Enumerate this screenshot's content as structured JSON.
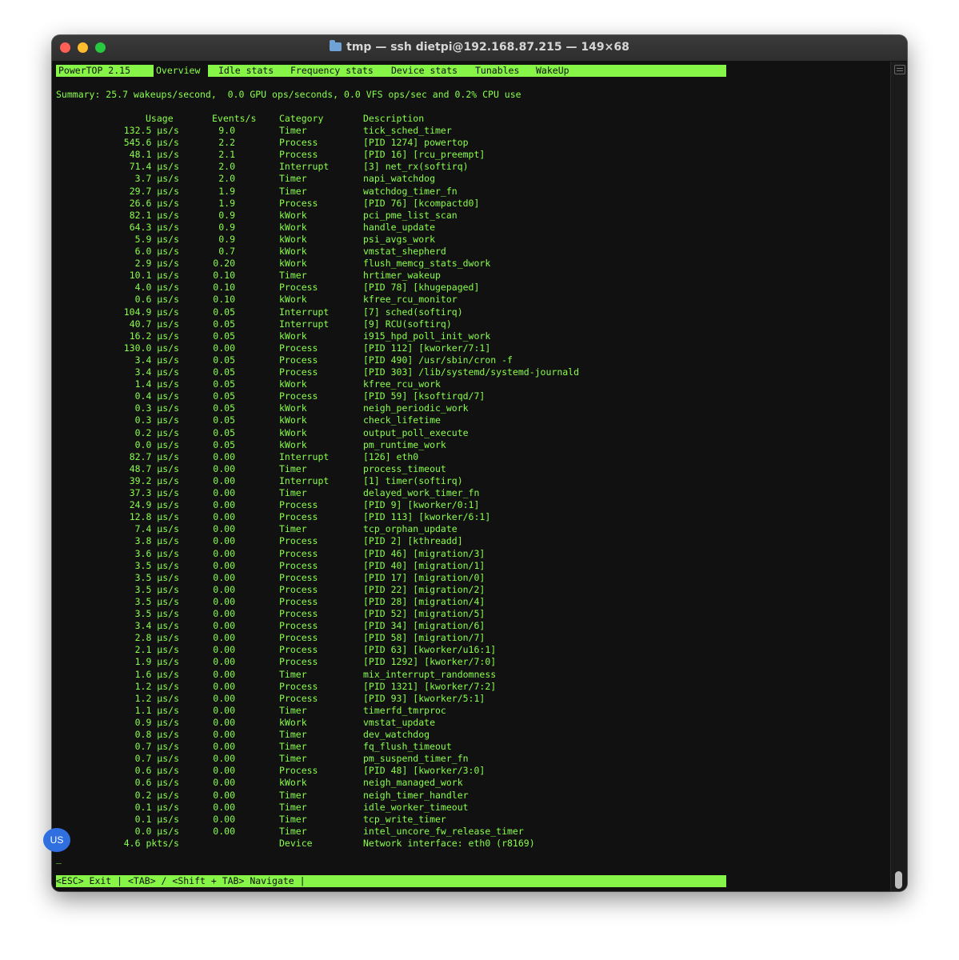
{
  "window": {
    "title": "tmp — ssh dietpi@192.168.87.215 — 149×68"
  },
  "tabs": [
    "PowerTOP 2.15",
    "Overview",
    "Idle stats",
    "Frequency stats",
    "Device stats",
    "Tunables",
    "WakeUp"
  ],
  "summary": "Summary: 25.7 wakeups/second,  0.0 GPU ops/seconds, 0.0 VFS ops/sec and 0.2% CPU use",
  "headers": {
    "usage": "Usage",
    "events": "Events/s",
    "category": "Category",
    "description": "Description"
  },
  "rows": [
    [
      "132.5 µs/s",
      "9.0",
      "Timer",
      "tick_sched_timer"
    ],
    [
      "545.6 µs/s",
      "2.2",
      "Process",
      "[PID 1274] powertop"
    ],
    [
      "48.1 µs/s",
      "2.1",
      "Process",
      "[PID 16] [rcu_preempt]"
    ],
    [
      "71.4 µs/s",
      "2.0",
      "Interrupt",
      "[3] net_rx(softirq)"
    ],
    [
      "3.7 µs/s",
      "2.0",
      "Timer",
      "napi_watchdog"
    ],
    [
      "29.7 µs/s",
      "1.9",
      "Timer",
      "watchdog_timer_fn"
    ],
    [
      "26.6 µs/s",
      "1.9",
      "Process",
      "[PID 76] [kcompactd0]"
    ],
    [
      "82.1 µs/s",
      "0.9",
      "kWork",
      "pci_pme_list_scan"
    ],
    [
      "64.3 µs/s",
      "0.9",
      "kWork",
      "handle_update"
    ],
    [
      "5.9 µs/s",
      "0.9",
      "kWork",
      "psi_avgs_work"
    ],
    [
      "6.0 µs/s",
      "0.7",
      "kWork",
      "vmstat_shepherd"
    ],
    [
      "2.9 µs/s",
      "0.20",
      "kWork",
      "flush_memcg_stats_dwork"
    ],
    [
      "10.1 µs/s",
      "0.10",
      "Timer",
      "hrtimer_wakeup"
    ],
    [
      "4.0 µs/s",
      "0.10",
      "Process",
      "[PID 78] [khugepaged]"
    ],
    [
      "0.6 µs/s",
      "0.10",
      "kWork",
      "kfree_rcu_monitor"
    ],
    [
      "104.9 µs/s",
      "0.05",
      "Interrupt",
      "[7] sched(softirq)"
    ],
    [
      "40.7 µs/s",
      "0.05",
      "Interrupt",
      "[9] RCU(softirq)"
    ],
    [
      "16.2 µs/s",
      "0.05",
      "kWork",
      "i915_hpd_poll_init_work"
    ],
    [
      "130.0 µs/s",
      "0.00",
      "Process",
      "[PID 112] [kworker/7:1]"
    ],
    [
      "3.4 µs/s",
      "0.05",
      "Process",
      "[PID 490] /usr/sbin/cron -f"
    ],
    [
      "3.4 µs/s",
      "0.05",
      "Process",
      "[PID 303] /lib/systemd/systemd-journald"
    ],
    [
      "1.4 µs/s",
      "0.05",
      "kWork",
      "kfree_rcu_work"
    ],
    [
      "0.4 µs/s",
      "0.05",
      "Process",
      "[PID 59] [ksoftirqd/7]"
    ],
    [
      "0.3 µs/s",
      "0.05",
      "kWork",
      "neigh_periodic_work"
    ],
    [
      "0.3 µs/s",
      "0.05",
      "kWork",
      "check_lifetime"
    ],
    [
      "0.2 µs/s",
      "0.05",
      "kWork",
      "output_poll_execute"
    ],
    [
      "0.0 µs/s",
      "0.05",
      "kWork",
      "pm_runtime_work"
    ],
    [
      "82.7 µs/s",
      "0.00",
      "Interrupt",
      "[126] eth0"
    ],
    [
      "48.7 µs/s",
      "0.00",
      "Timer",
      "process_timeout"
    ],
    [
      "39.2 µs/s",
      "0.00",
      "Interrupt",
      "[1] timer(softirq)"
    ],
    [
      "37.3 µs/s",
      "0.00",
      "Timer",
      "delayed_work_timer_fn"
    ],
    [
      "24.9 µs/s",
      "0.00",
      "Process",
      "[PID 9] [kworker/0:1]"
    ],
    [
      "12.8 µs/s",
      "0.00",
      "Process",
      "[PID 113] [kworker/6:1]"
    ],
    [
      "7.4 µs/s",
      "0.00",
      "Timer",
      "tcp_orphan_update"
    ],
    [
      "3.8 µs/s",
      "0.00",
      "Process",
      "[PID 2] [kthreadd]"
    ],
    [
      "3.6 µs/s",
      "0.00",
      "Process",
      "[PID 46] [migration/3]"
    ],
    [
      "3.5 µs/s",
      "0.00",
      "Process",
      "[PID 40] [migration/1]"
    ],
    [
      "3.5 µs/s",
      "0.00",
      "Process",
      "[PID 17] [migration/0]"
    ],
    [
      "3.5 µs/s",
      "0.00",
      "Process",
      "[PID 22] [migration/2]"
    ],
    [
      "3.5 µs/s",
      "0.00",
      "Process",
      "[PID 28] [migration/4]"
    ],
    [
      "3.5 µs/s",
      "0.00",
      "Process",
      "[PID 52] [migration/5]"
    ],
    [
      "3.4 µs/s",
      "0.00",
      "Process",
      "[PID 34] [migration/6]"
    ],
    [
      "2.8 µs/s",
      "0.00",
      "Process",
      "[PID 58] [migration/7]"
    ],
    [
      "2.1 µs/s",
      "0.00",
      "Process",
      "[PID 63] [kworker/u16:1]"
    ],
    [
      "1.9 µs/s",
      "0.00",
      "Process",
      "[PID 1292] [kworker/7:0]"
    ],
    [
      "1.6 µs/s",
      "0.00",
      "Timer",
      "mix_interrupt_randomness"
    ],
    [
      "1.2 µs/s",
      "0.00",
      "Process",
      "[PID 1321] [kworker/7:2]"
    ],
    [
      "1.2 µs/s",
      "0.00",
      "Process",
      "[PID 93] [kworker/5:1]"
    ],
    [
      "1.1 µs/s",
      "0.00",
      "Timer",
      "timerfd_tmrproc"
    ],
    [
      "0.9 µs/s",
      "0.00",
      "kWork",
      "vmstat_update"
    ],
    [
      "0.8 µs/s",
      "0.00",
      "Timer",
      "dev_watchdog"
    ],
    [
      "0.7 µs/s",
      "0.00",
      "Timer",
      "fq_flush_timeout"
    ],
    [
      "0.7 µs/s",
      "0.00",
      "Timer",
      "pm_suspend_timer_fn"
    ],
    [
      "0.6 µs/s",
      "0.00",
      "Process",
      "[PID 48] [kworker/3:0]"
    ],
    [
      "0.6 µs/s",
      "0.00",
      "kWork",
      "neigh_managed_work"
    ],
    [
      "0.2 µs/s",
      "0.00",
      "Timer",
      "neigh_timer_handler"
    ],
    [
      "0.1 µs/s",
      "0.00",
      "Timer",
      "idle_worker_timeout"
    ],
    [
      "0.1 µs/s",
      "0.00",
      "Timer",
      "tcp_write_timer"
    ],
    [
      "0.0 µs/s",
      "0.00",
      "Timer",
      "intel_uncore_fw_release_timer"
    ],
    [
      "4.6 pkts/s",
      "",
      "Device",
      "Network interface: eth0 (r8169)"
    ]
  ],
  "cursor": "_",
  "footer": "<ESC> Exit | <TAB> / <Shift + TAB> Navigate |",
  "badge": "US",
  "colors": {
    "terminal_green": "#89ff4b",
    "bar_green": "#86f548",
    "background": "#111111"
  }
}
